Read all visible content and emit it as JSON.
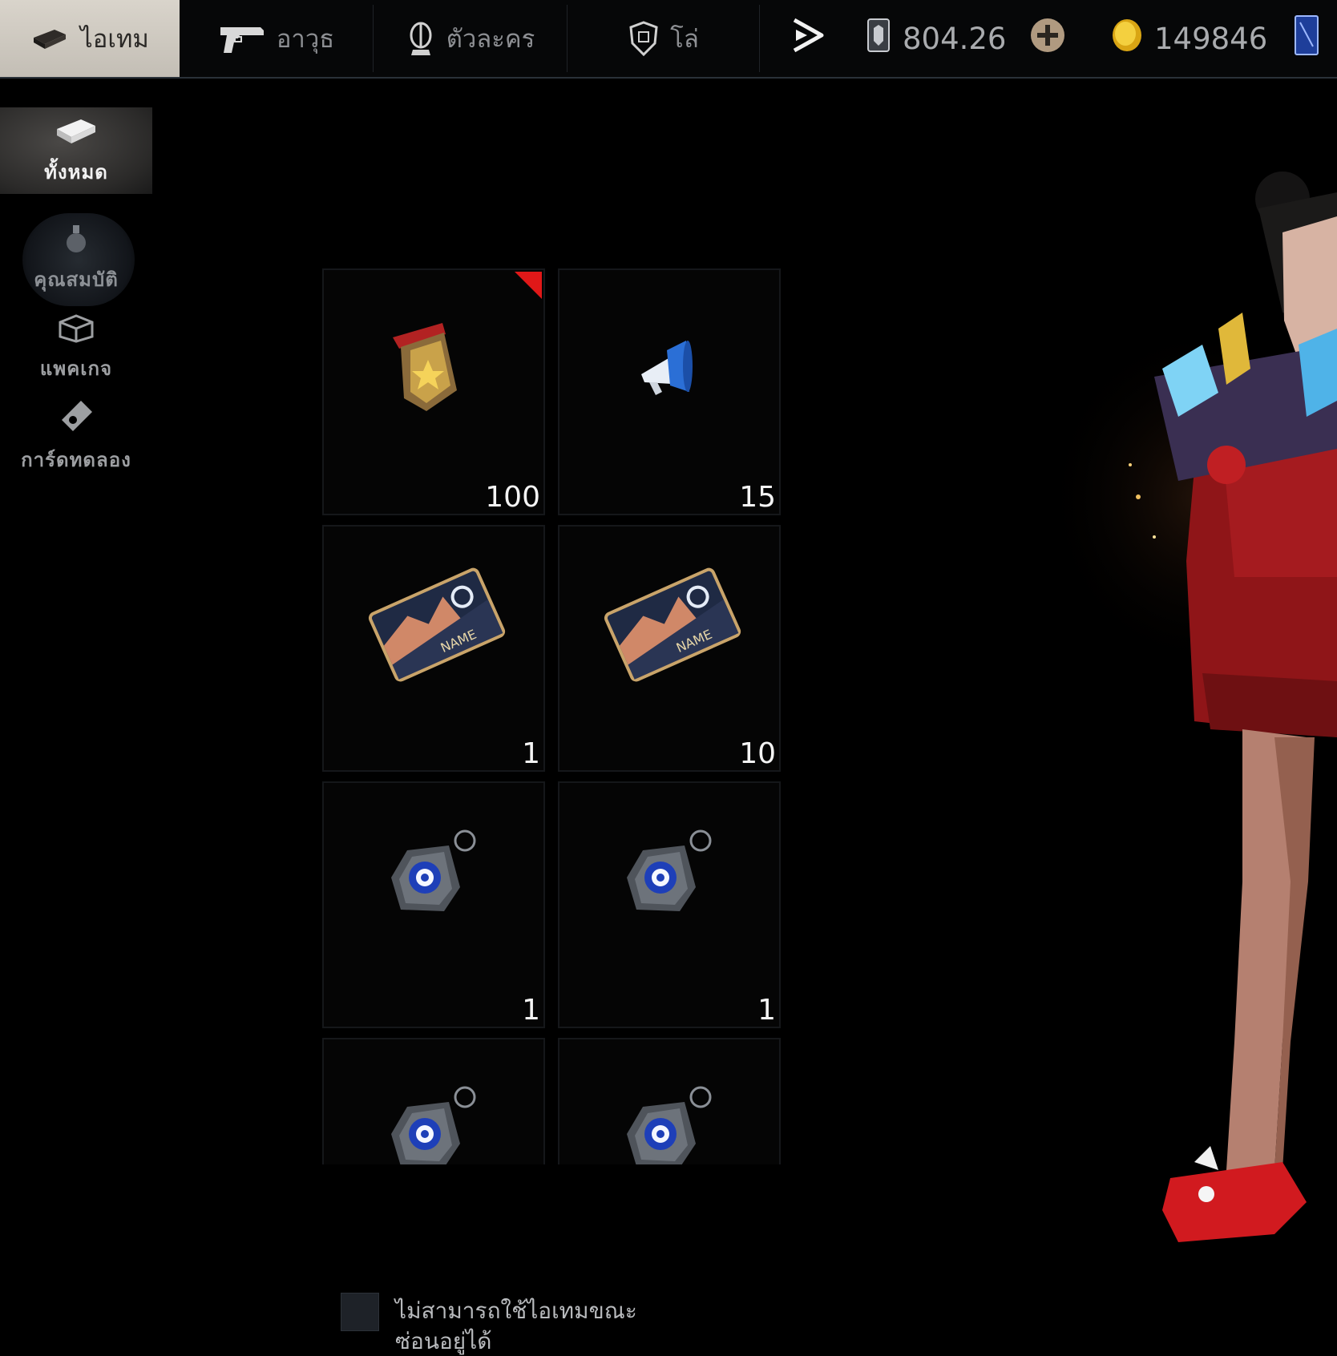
{
  "top_tabs": [
    {
      "label": "ไอเทม",
      "icon": "item-box-icon",
      "active": true
    },
    {
      "label": "อาวุธ",
      "icon": "pistol-icon",
      "active": false
    },
    {
      "label": "ตัวละคร",
      "icon": "character-icon",
      "active": false
    },
    {
      "label": "โล่",
      "icon": "shield-icon",
      "active": false
    }
  ],
  "currencies": {
    "play_icon": "play-arrow-icon",
    "diamond_value": "804.26",
    "diamond_icon": "diamond-card-icon",
    "add_icon": "plus-icon",
    "gold_value": "149846",
    "gold_icon": "gold-coin-icon",
    "extra_icon": "blue-card-icon"
  },
  "sidebar": [
    {
      "label": "ทั้งหมด",
      "icon": "item-box-icon",
      "active": true
    },
    {
      "label": "คุณสมบัติ",
      "icon": "grenade-icon",
      "active": false
    },
    {
      "label": "แพคเกจ",
      "icon": "package-icon",
      "active": false
    },
    {
      "label": "การ์ดทดลอง",
      "icon": "trial-card-icon",
      "active": false
    }
  ],
  "items": [
    {
      "icon": "medal-icon",
      "qty": "100",
      "new": true
    },
    {
      "icon": "megaphone-icon",
      "qty": "15",
      "new": false
    },
    {
      "icon": "name-change-card-icon",
      "qty": "1",
      "new": false
    },
    {
      "icon": "name-change-card-icon",
      "qty": "10",
      "new": false
    },
    {
      "icon": "dog-tag-icon",
      "qty": "1",
      "new": false
    },
    {
      "icon": "dog-tag-icon",
      "qty": "1",
      "new": false
    },
    {
      "icon": "dog-tag-icon",
      "qty": "",
      "new": false
    },
    {
      "icon": "dog-tag-icon",
      "qty": "",
      "new": false
    }
  ],
  "footer": {
    "hide_items_label": "ไม่สามารถใช้ไอเทมขณะซ่อนอยู่ได้",
    "checked": false
  },
  "colors": {
    "accent_red": "#e01818",
    "gold": "#e8b52a",
    "tab_active_bg": "#d9d4cb"
  }
}
